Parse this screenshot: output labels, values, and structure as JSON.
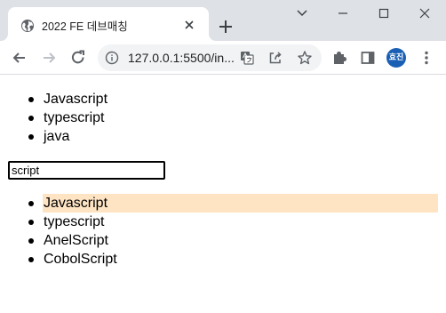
{
  "browser": {
    "tab": {
      "title": "2022 FE 데브매칭"
    },
    "address_bar": {
      "url": "127.0.0.1:5500/in..."
    },
    "profile": {
      "initials": "효진",
      "color": "#1a5fb4"
    }
  },
  "page": {
    "languages": [
      "Javascript",
      "typescript",
      "java"
    ],
    "search": {
      "value": "script"
    },
    "suggestions": {
      "items": [
        "Javascript",
        "typescript",
        "AnelScript",
        "CobolScript"
      ],
      "selected_index": 0,
      "highlight_color": "#ffe4c4"
    }
  }
}
